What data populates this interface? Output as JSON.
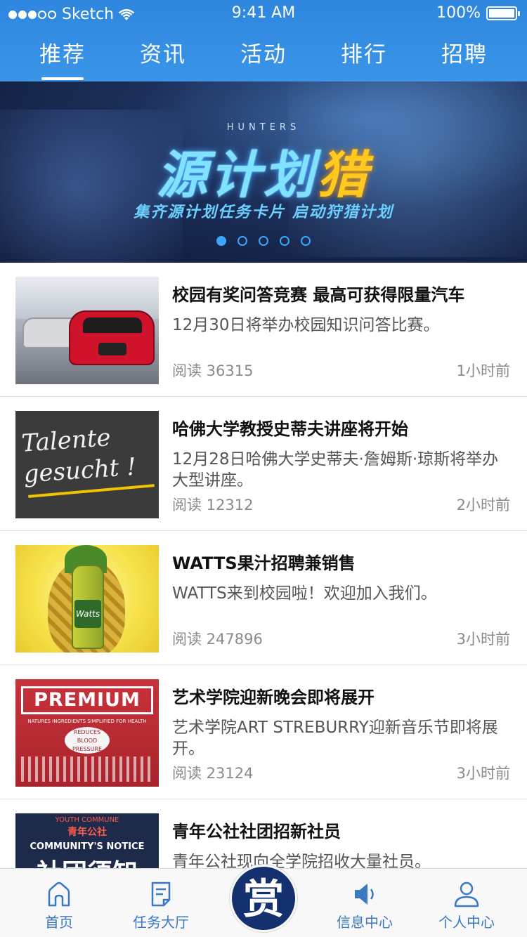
{
  "status": {
    "carrier": "Sketch",
    "time": "9:41 AM",
    "battery": "100%"
  },
  "tabs": [
    {
      "label": "推荐",
      "active": true
    },
    {
      "label": "资讯",
      "active": false
    },
    {
      "label": "活动",
      "active": false
    },
    {
      "label": "排行",
      "active": false
    },
    {
      "label": "招聘",
      "active": false
    }
  ],
  "banner": {
    "subtitle": "HUNTERS",
    "title_part1": "源计划",
    "title_part2": "猎",
    "slogan": "集齐源计划任务卡片 启动狩猎计划",
    "page_count": 5,
    "active_page": 0
  },
  "articles": [
    {
      "title": "校园有奖问答竞赛 最高可获得限量汽车",
      "desc": "12月30日将举办校园知识问答比赛。",
      "reads": "阅读 36315",
      "time": "1小时前",
      "thumb": "car",
      "thumb_text": ""
    },
    {
      "title": "哈佛大学教授史蒂夫讲座将开始",
      "desc": "12月28日哈佛大学史蒂夫·詹姆斯·琼斯将举办大型讲座。",
      "reads": "阅读 12312",
      "time": "2小时前",
      "thumb": "talent",
      "thumb_text": "Talente gesucht !"
    },
    {
      "title": "WATTS果汁招聘兼销售",
      "desc": "WATTS来到校园啦！欢迎加入我们。",
      "reads": "阅读 247896",
      "time": "3小时前",
      "thumb": "watts",
      "thumb_text": "Watts"
    },
    {
      "title": "艺术学院迎新晚会即将展开",
      "desc": "艺术学院ART STREBURRY迎新音乐节即将展开。",
      "reads": "阅读 23124",
      "time": "3小时前",
      "thumb": "premium",
      "thumb_text": "PREMIUM",
      "thumb_sub": "NATURES INGREDIENTS SIMPLIFIED FOR HEALTH",
      "thumb_bubble": "REDUCES BLOOD PRESSURE"
    },
    {
      "title": "青年公社社团招新社员",
      "desc": "青年公社现向全学院招收大量社员。",
      "reads": "",
      "time": "",
      "thumb": "youth",
      "thumb_text": "YOUTH COMMUNE",
      "thumb_cn": "青年公社",
      "thumb_notice": "COMMUNITY'S NOTICE",
      "thumb_big": "社团须知"
    }
  ],
  "tabbar": {
    "home": "首页",
    "tasks": "任务大厅",
    "center_char": "赏",
    "messages": "信息中心",
    "profile": "个人中心"
  },
  "colors": {
    "header": "#2e86de",
    "accent": "#3a78c2",
    "center_button": "#15306f"
  }
}
